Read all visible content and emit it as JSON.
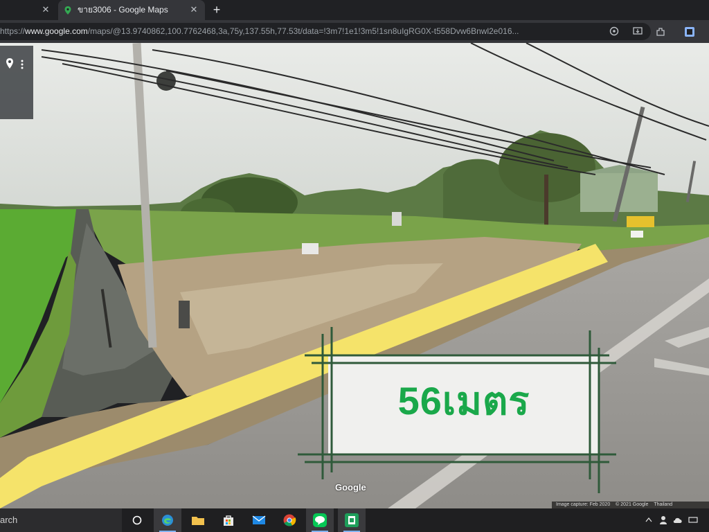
{
  "browser": {
    "tabs": [
      {
        "label": ""
      },
      {
        "label": "ขาย3006 - Google Maps",
        "icon": "google-maps-pin-icon"
      }
    ],
    "url": {
      "scheme": "https://",
      "host": "www.google.com",
      "path": "/maps/@13.9740862,100.7762468,3a,75y,137.55h,77.53t/data=!3m7!1e1!3m5!1sn8uIgRG0X-t558Dvw6Bnwl2e016..."
    },
    "toolbar_icons": [
      "location-icon",
      "install-icon",
      "extensions-icon",
      "profile-icon"
    ]
  },
  "streetview": {
    "sign_label": "56เมตร",
    "watermark": "Google",
    "footer": {
      "capture": "Image capture: Feb 2020",
      "copyright": "© 2021 Google",
      "region": "Thailand"
    },
    "colors": {
      "highlight": "#f5e36a",
      "frame": "#2f5a3a",
      "label": "#1aa84a"
    }
  },
  "taskbar": {
    "search_text": "arch",
    "apps": [
      "cortana-icon",
      "edge-icon",
      "file-explorer-icon",
      "store-icon",
      "mail-icon",
      "chrome-icon",
      "line-icon",
      "green-app-icon"
    ]
  }
}
